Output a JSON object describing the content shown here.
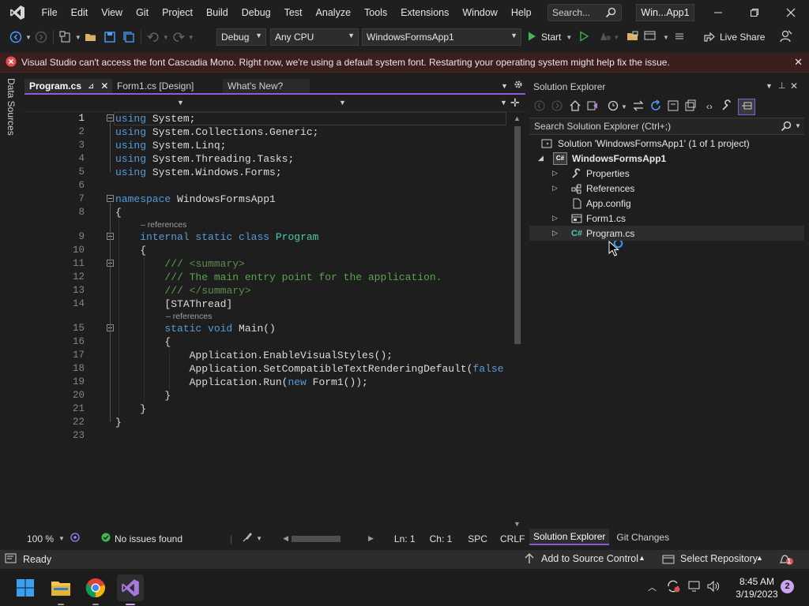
{
  "titlebar": {
    "menu": [
      "File",
      "Edit",
      "View",
      "Git",
      "Project",
      "Build",
      "Debug",
      "Test",
      "Analyze",
      "Tools",
      "Extensions",
      "Window",
      "Help"
    ],
    "search_placeholder": "Search...",
    "solution_name": "Win...App1"
  },
  "toolbar": {
    "config": "Debug",
    "platform": "Any CPU",
    "startup_project": "WindowsFormsApp1",
    "start_label": "Start",
    "live_share": "Live Share"
  },
  "infobar": {
    "message": "Visual Studio can't access the font Cascadia Mono. Right now, we're using a default system font. Restarting your operating system might help fix the issue."
  },
  "left_strip": {
    "label": "Data Sources"
  },
  "editor": {
    "tabs": [
      {
        "label": "Program.cs",
        "active": true
      },
      {
        "label": "Form1.cs [Design]",
        "active": false
      },
      {
        "label": "What's New?",
        "active": false
      }
    ],
    "lens_text": "– references",
    "lines": [
      {
        "n": "1",
        "segs": [
          [
            "kw",
            "using"
          ],
          [
            "pl",
            " System;"
          ]
        ]
      },
      {
        "n": "2",
        "segs": [
          [
            "kw",
            "using"
          ],
          [
            "pl",
            " System.Collections.Generic;"
          ]
        ]
      },
      {
        "n": "3",
        "segs": [
          [
            "kw",
            "using"
          ],
          [
            "pl",
            " System.Linq;"
          ]
        ]
      },
      {
        "n": "4",
        "segs": [
          [
            "kw",
            "using"
          ],
          [
            "pl",
            " System.Threading.Tasks;"
          ]
        ]
      },
      {
        "n": "5",
        "segs": [
          [
            "kw",
            "using"
          ],
          [
            "pl",
            " System.Windows.Forms;"
          ]
        ]
      },
      {
        "n": "6",
        "segs": []
      },
      {
        "n": "7",
        "segs": [
          [
            "kw",
            "namespace"
          ],
          [
            "pl",
            " WindowsFormsApp1"
          ]
        ]
      },
      {
        "n": "8",
        "segs": [
          [
            "pl",
            "{"
          ]
        ]
      },
      {
        "n": "9",
        "segs": [
          [
            "pl",
            "    "
          ],
          [
            "kw",
            "internal static class"
          ],
          [
            "pl",
            " "
          ],
          [
            "ty",
            "Program"
          ]
        ]
      },
      {
        "n": "10",
        "segs": [
          [
            "pl",
            "    {"
          ]
        ]
      },
      {
        "n": "11",
        "segs": [
          [
            "pl",
            "        "
          ],
          [
            "cm",
            "/// "
          ],
          [
            "cm-tag",
            "<summary>"
          ]
        ]
      },
      {
        "n": "12",
        "segs": [
          [
            "pl",
            "        "
          ],
          [
            "cm",
            "/// The main entry point for the application."
          ]
        ]
      },
      {
        "n": "13",
        "segs": [
          [
            "pl",
            "        "
          ],
          [
            "cm",
            "/// "
          ],
          [
            "cm-tag",
            "</summary>"
          ]
        ]
      },
      {
        "n": "14",
        "segs": [
          [
            "pl",
            "        [STAThread]"
          ]
        ]
      },
      {
        "n": "15",
        "segs": [
          [
            "pl",
            "        "
          ],
          [
            "kw",
            "static void"
          ],
          [
            "pl",
            " Main()"
          ]
        ]
      },
      {
        "n": "16",
        "segs": [
          [
            "pl",
            "        {"
          ]
        ]
      },
      {
        "n": "17",
        "segs": [
          [
            "pl",
            "            Application.EnableVisualStyles();"
          ]
        ]
      },
      {
        "n": "18",
        "segs": [
          [
            "pl",
            "            Application.SetCompatibleTextRenderingDefault("
          ],
          [
            "kw",
            "false"
          ]
        ]
      },
      {
        "n": "19",
        "segs": [
          [
            "pl",
            "            Application.Run("
          ],
          [
            "kw",
            "new"
          ],
          [
            "pl",
            " Form1());"
          ]
        ]
      },
      {
        "n": "20",
        "segs": [
          [
            "pl",
            "        }"
          ]
        ]
      },
      {
        "n": "21",
        "segs": [
          [
            "pl",
            "    }"
          ]
        ]
      },
      {
        "n": "22",
        "segs": [
          [
            "pl",
            "}"
          ]
        ]
      },
      {
        "n": "23",
        "segs": []
      }
    ],
    "status": {
      "zoom": "100 %",
      "issues": "No issues found",
      "ln": "Ln: 1",
      "ch": "Ch: 1",
      "spc": "SPC",
      "eol": "CRLF"
    }
  },
  "solution_explorer": {
    "title": "Solution Explorer",
    "search_placeholder": "Search Solution Explorer (Ctrl+;)",
    "solution_label": "Solution 'WindowsFormsApp1' (1 of 1 project)",
    "project": "WindowsFormsApp1",
    "items": [
      "Properties",
      "References",
      "App.config",
      "Form1.cs",
      "Program.cs"
    ],
    "tabs": [
      "Solution Explorer",
      "Git Changes"
    ]
  },
  "statusbar": {
    "ready": "Ready",
    "add_source": "Add to Source Control",
    "select_repo": "Select Repository",
    "notif_count": "1"
  },
  "taskbar": {
    "time": "8:45 AM",
    "date": "3/19/2023",
    "badge": "2"
  }
}
